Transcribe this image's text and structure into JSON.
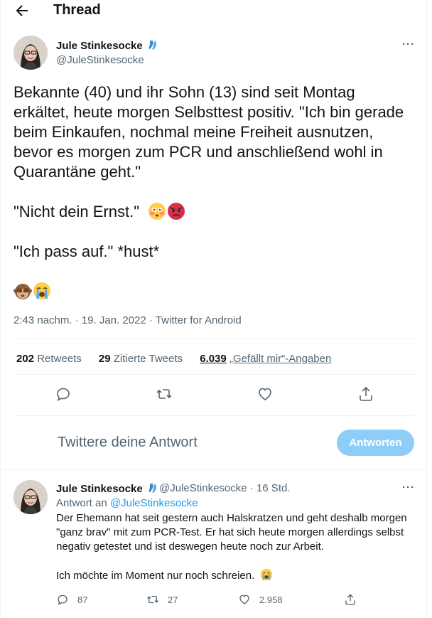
{
  "header": {
    "title": "Thread"
  },
  "tweet": {
    "author_name": "Jule Stinkesocke",
    "author_handle": "@JuleStinkesocke",
    "text_lines": [
      "Bekannte (40) und ihr Sohn (13) sind seit Montag erkältet, heute morgen Selbsttest positiv. \"Ich bin gerade beim Einkaufen, nochmal meine Freiheit ausnutzen, bevor es morgen zum PCR und anschließend wohl in Quarantäne geht.\"",
      "\"Nicht dein Ernst.\"",
      "\"Ich pass auf.\" *hust*"
    ],
    "meta": "2:43 nachm. · 19. Jan. 2022 · Twitter for Android",
    "retweets_count": "202",
    "retweets_label": "Retweets",
    "quotes_count": "29",
    "quotes_label": "Zitierte Tweets",
    "likes_count": "6.039",
    "likes_label": "„Gefällt mir“-Angaben"
  },
  "reply_composer": {
    "placeholder": "Twittere deine Antwort",
    "button_label": "Antworten"
  },
  "reply": {
    "author_name": "Jule Stinkesocke",
    "author_handle": "@JuleStinkesocke",
    "time": "· 16 Std.",
    "replying_to_prefix": "Antwort an",
    "replying_to_handle": "@JuleStinkesocke",
    "paragraph_1": "Der Ehemann hat seit gestern auch Halskratzen und geht deshalb morgen \"ganz brav\" mit zum PCR-Test. Er hat sich heute morgen allerdings selbst negativ getestet und ist deswegen heute noch zur Arbeit.",
    "paragraph_2": "Ich möchte im Moment nur noch schreien.",
    "replies_count": "87",
    "retweets_count": "27",
    "likes_count": "2.958"
  },
  "colors": {
    "link": "#1d9bf0",
    "secondary_text": "#536471",
    "button_disabled": "#8ecdf8"
  }
}
